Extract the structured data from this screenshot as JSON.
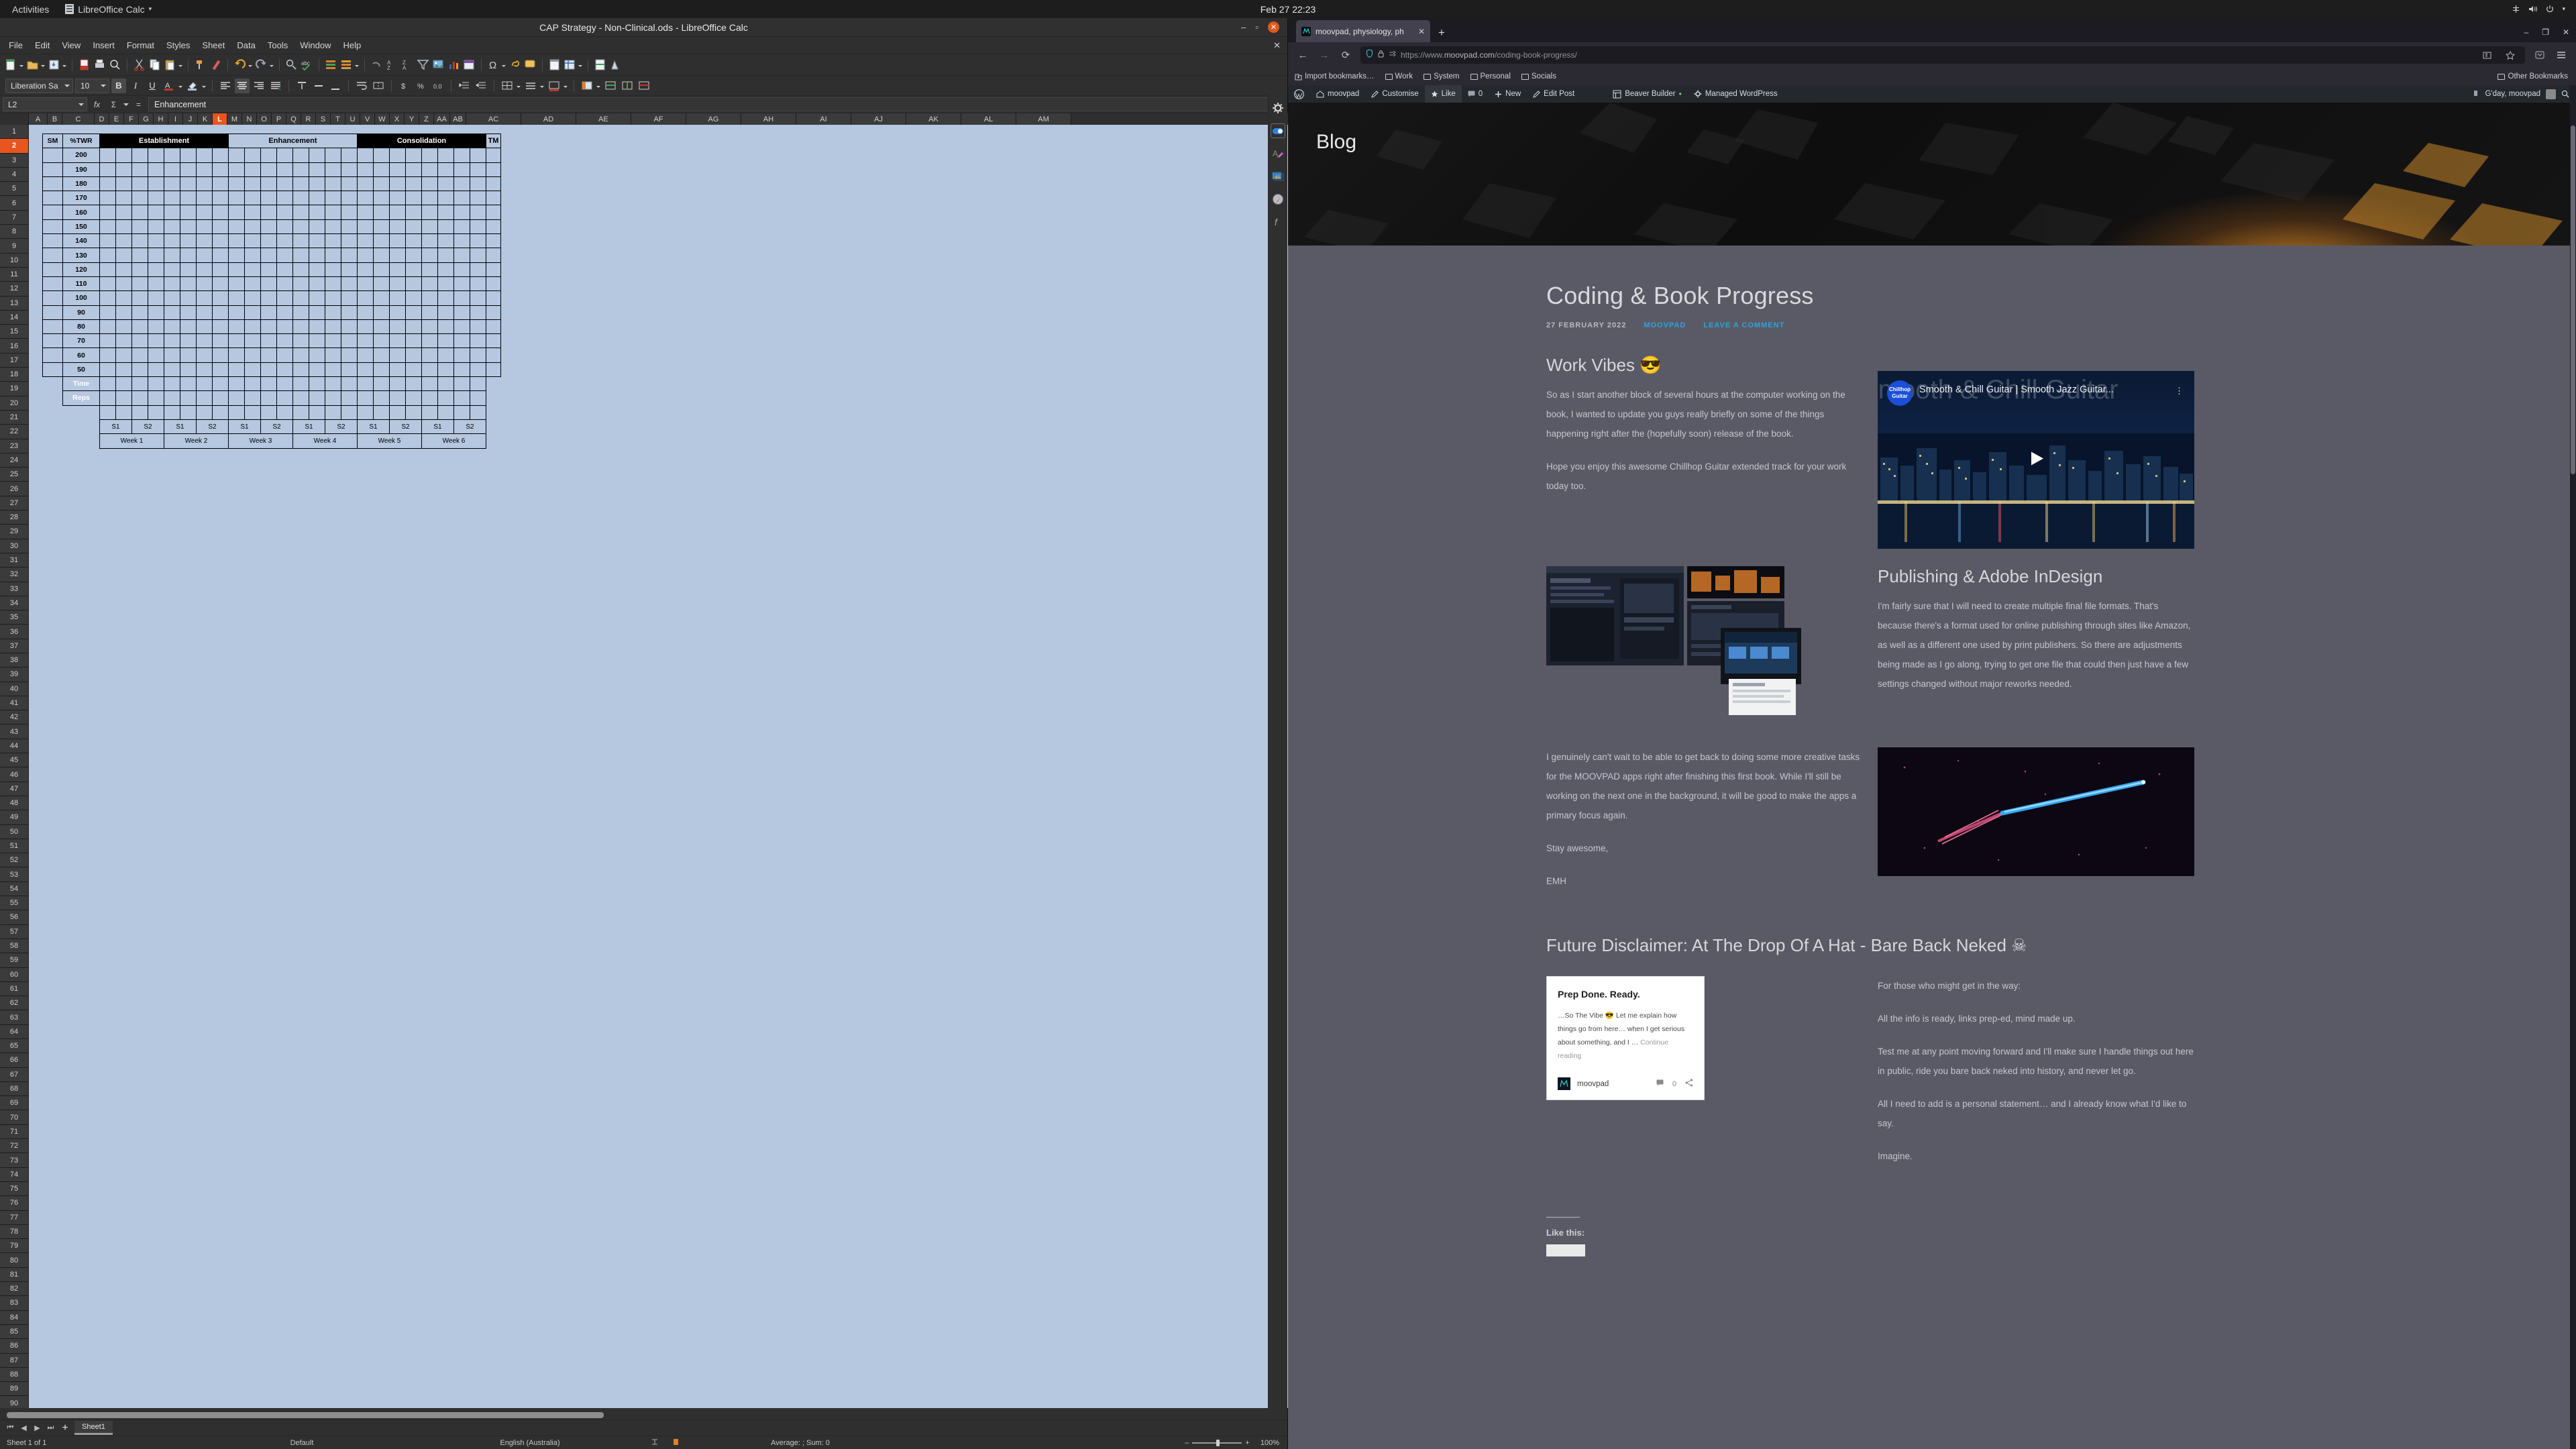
{
  "gnome": {
    "activities": "Activities",
    "app_menu": "LibreOffice Calc",
    "app_menu_caret": "▾",
    "clock": "Feb 27  22:23",
    "icons": [
      "network-icon",
      "volume-icon",
      "power-icon",
      "chevron-down-icon"
    ]
  },
  "libreoffice": {
    "title": "CAP Strategy - Non-Clinical.ods - LibreOffice Calc",
    "window_controls": {
      "minimize": "–",
      "maximize": "▫",
      "close": "✕"
    },
    "menus": [
      "File",
      "Edit",
      "View",
      "Insert",
      "Format",
      "Styles",
      "Sheet",
      "Data",
      "Tools",
      "Window",
      "Help"
    ],
    "menu_close": "✕",
    "font_name": "Liberation Sa",
    "font_size": "10",
    "bold_label": "B",
    "italic_label": "I",
    "underline_label": "U",
    "name_box": "L2",
    "formula_sum": "Σ",
    "formula_equals": "=",
    "formula_fx": "fx",
    "input_line": "Enhancement",
    "selected_column": "L",
    "selected_row": "2",
    "columns": [
      "A",
      "B",
      "C",
      "D",
      "E",
      "F",
      "G",
      "H",
      "I",
      "J",
      "K",
      "L",
      "M",
      "N",
      "O",
      "P",
      "Q",
      "R",
      "S",
      "T",
      "U",
      "V",
      "W",
      "X",
      "Y",
      "Z",
      "AA",
      "AB",
      "AC",
      "AD",
      "AE",
      "AF",
      "AG",
      "AH",
      "AI",
      "AJ",
      "AK",
      "AL",
      "AM"
    ],
    "sheet_tab": "Sheet1",
    "nav_first": "⏮",
    "nav_prev": "◀",
    "nav_next": "▶",
    "nav_last": "⏭",
    "nav_add": "+",
    "status": {
      "sheet_count": "Sheet 1 of 1",
      "page_style": "Default",
      "language": "English (Australia)",
      "selection_mode": "insert-mode-icon",
      "modified": "document-modified-icon",
      "average_sum": "Average: ; Sum: 0",
      "zoom_out": "–",
      "zoom_in": "+",
      "zoom_level": "100%"
    },
    "sidebar_icons": [
      "gear-icon",
      "sidebar-properties-icon",
      "styles-icon",
      "gallery-icon",
      "navigator-icon",
      "functions-icon"
    ],
    "table": {
      "col_sm": "SM",
      "col_twr": "%TWR",
      "phases": [
        {
          "label": "Establishment",
          "style": "dark",
          "span": 8
        },
        {
          "label": "Enhancement",
          "style": "light",
          "span": 8
        },
        {
          "label": "Consolidation",
          "style": "dark",
          "span": 8
        },
        {
          "label": "TM",
          "style": "light",
          "span": 1
        }
      ],
      "twr_values": [
        "200",
        "190",
        "180",
        "170",
        "160",
        "150",
        "140",
        "130",
        "120",
        "110",
        "100",
        "90",
        "80",
        "70",
        "60",
        "50"
      ],
      "footer_rows": [
        "Time",
        "Reps"
      ],
      "sessions": [
        "S1",
        "S2",
        "S1",
        "S2",
        "S1",
        "S2",
        "S1",
        "S2",
        "S1",
        "S2",
        "S1",
        "S2"
      ],
      "weeks": [
        "Week 1",
        "Week 2",
        "Week 3",
        "Week 4",
        "Week 5",
        "Week 6"
      ]
    }
  },
  "firefox": {
    "tab": {
      "title": "moovpad, physiology, ph",
      "close": "✕",
      "favicon": "moovpad-favicon"
    },
    "new_tab": "+",
    "window_controls": {
      "minimize": "–",
      "maximize": "❐",
      "close": "✕"
    },
    "nav": {
      "back": "←",
      "forward": "→",
      "reload": "⟳"
    },
    "url_scheme": "https://www.",
    "url_host": "moovpad.com",
    "url_path": "/coding-book-progress/",
    "bookmarks": [
      {
        "label": "Import bookmarks…",
        "icon": "import-bookmarks-icon"
      },
      {
        "label": "Work",
        "icon": "folder-icon"
      },
      {
        "label": "System",
        "icon": "folder-icon"
      },
      {
        "label": "Personal",
        "icon": "folder-icon"
      },
      {
        "label": "Socials",
        "icon": "folder-icon"
      }
    ],
    "other_bookmarks": "Other Bookmarks"
  },
  "wpadmin": {
    "items": [
      {
        "label": "",
        "icon": "wordpress-logo-icon"
      },
      {
        "label": "moovpad",
        "icon": "home-icon"
      },
      {
        "label": "Customise",
        "icon": "pencil-icon"
      },
      {
        "label": "Like",
        "icon": "star-icon"
      },
      {
        "label": "0",
        "icon": "comment-icon"
      },
      {
        "label": "New",
        "icon": "plus-icon"
      },
      {
        "label": "Edit Post",
        "icon": "edit-icon"
      },
      {
        "label": "Beaver Builder",
        "icon": "beaver-builder-icon"
      },
      {
        "label": "Managed WordPress",
        "icon": "gear-icon"
      }
    ],
    "greeting": "G'day, moovpad",
    "search_icon": "search-icon"
  },
  "page": {
    "banner_title": "Blog",
    "post_title": "Coding & Book Progress",
    "post_date": "27 FEBRUARY 2022",
    "post_author": "MOOVPAD",
    "post_comment_link": "LEAVE A COMMENT",
    "section1": {
      "heading": "Work Vibes 😎",
      "p1": "So as I start another block of several hours at the computer working on the book, I wanted to update you guys really briefly on some of the things happening right after the (hopefully soon) release of the book.",
      "p2": "Hope you enjoy this awesome Chillhop Guitar extended track for your work today too."
    },
    "video": {
      "channel_badge": "Chillhop Guitar",
      "title": "Smooth & Chill Guitar | Smooth Jazz Guitar...",
      "ghost_title": "Smooth & Chill Guitar",
      "menu": "⋮",
      "play": "play-button-icon"
    },
    "section2": {
      "heading": "Publishing & Adobe InDesign",
      "p1": "I'm fairly sure that I will need to create multiple final file formats. That's because there's a format used for online publishing through sites like Amazon, as well as a different one used by print publishers. So there are adjustments being made as I go along, trying to get one file that could then just have a few settings changed without major reworks needed."
    },
    "section3": {
      "p1": "I genuinely can't wait to be able to get back to doing some more creative tasks for the MOOVPAD apps right after finishing this first book. While I'll still be working on the next one in the background, it will be good to make the apps a primary focus again.",
      "p2": "Stay awesome,",
      "p3": "EMH"
    },
    "section4": {
      "heading": "Future Disclaimer: At The Drop Of A Hat - Bare Back Neked ☠",
      "p1": "For those who might get in the way:",
      "p2": "All the info is ready, links prep-ed, mind made up.",
      "p3": "Test me at any point moving forward and I'll make sure I handle things out here in public, ride you bare back neked into history, and never let go.",
      "p4": "All I need to add is a personal statement… and I already know what I'd like to say.",
      "p5": "Imagine."
    },
    "embed_card": {
      "title": "Prep Done. Ready.",
      "excerpt": "…So The Vibe 😎 Let me explain how things go from here… when I get serious about something, and I …",
      "continue": "Continue reading",
      "site": "moovpad",
      "comment_count": "0",
      "comment_icon": "comment-icon",
      "share_icon": "share-icon",
      "logo": "moovpad-logo-icon"
    },
    "like_label": "Like this:"
  },
  "colors": {
    "accent_blue": "#2ea3d8",
    "page_bg": "#5a5a66",
    "sheet_bg": "#b6c8e0",
    "selection_orange": "#e8551f"
  }
}
